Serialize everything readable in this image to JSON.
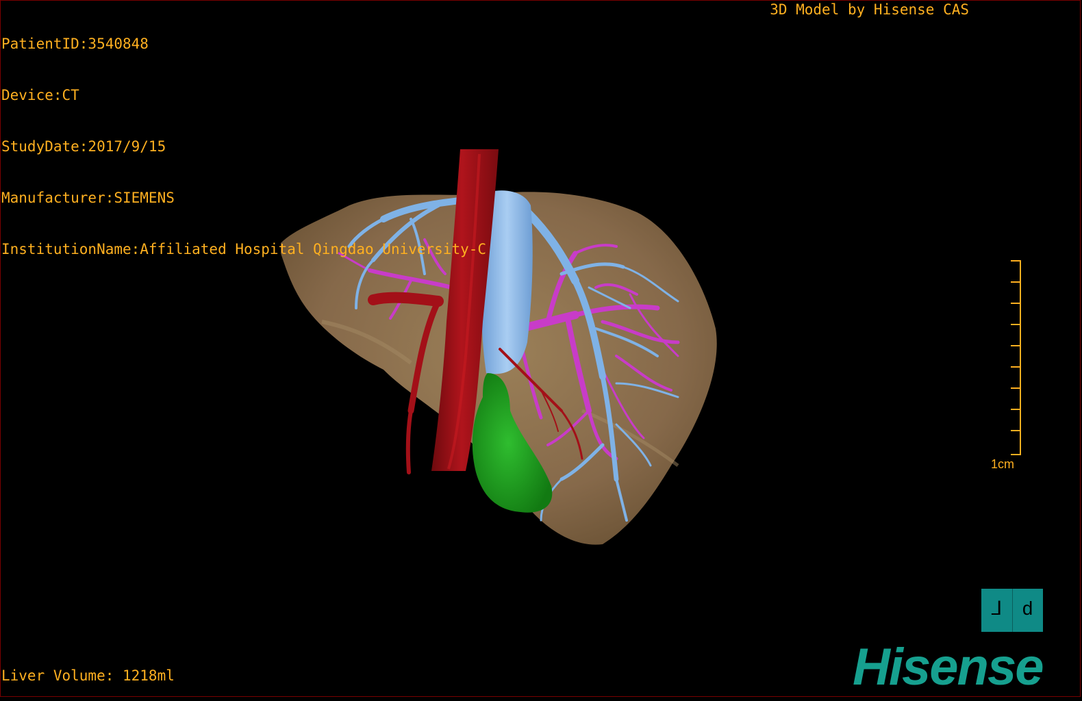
{
  "header": {
    "patient_id": "PatientID:3540848",
    "device": "Device:CT",
    "study_date": "StudyDate:2017/9/15",
    "manufacturer": "Manufacturer:SIEMENS",
    "institution": "InstitutionName:Affiliated Hospital Qingdao University-C"
  },
  "credit": "3D Model by Hisense CAS",
  "footer": {
    "liver_volume": "Liver Volume: 1218ml"
  },
  "scale": {
    "label": "1cm"
  },
  "orientation": {
    "left_glyph": "⅃",
    "right_glyph": "d"
  },
  "brand": {
    "name": "Hisense",
    "color": "#16a08f"
  },
  "colors": {
    "overlay_text": "#ffb020",
    "liver": "#8a6f4a",
    "aorta": "#9b0e14",
    "hepatic_vein": "#7fb2e6",
    "portal_vein": "#c83cc8",
    "gallbladder": "#1d9a1d",
    "background": "#000000"
  }
}
